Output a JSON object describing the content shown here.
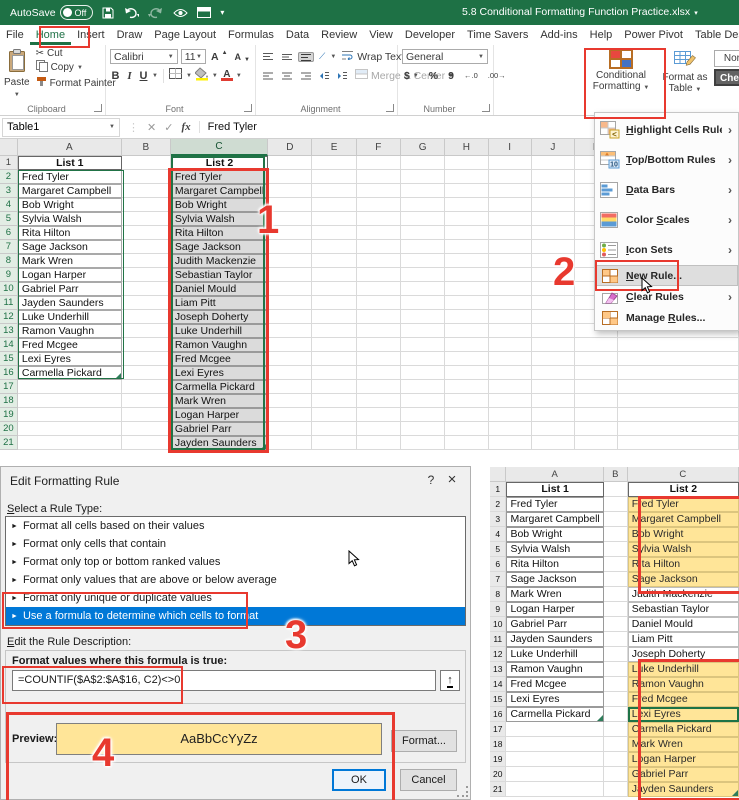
{
  "titlebar": {
    "autosave_label": "AutoSave",
    "autosave_state": "Off",
    "title": "5.8 Conditional Formatting Function Practice.xlsx"
  },
  "tabs": {
    "items": [
      "File",
      "Home",
      "Insert",
      "Draw",
      "Page Layout",
      "Formulas",
      "Data",
      "Review",
      "View",
      "Developer",
      "Time Savers",
      "Add-ins",
      "Help",
      "Power Pivot",
      "Table Des"
    ],
    "active": "Home"
  },
  "ribbon": {
    "clipboard": {
      "group_label": "Clipboard",
      "paste": "Paste",
      "cut": "Cut",
      "copy": "Copy",
      "format_painter": "Format Painter"
    },
    "font": {
      "group_label": "Font",
      "font_name": "Calibri",
      "font_size": "11",
      "bold": "B",
      "italic": "I",
      "underline": "U"
    },
    "alignment": {
      "group_label": "Alignment",
      "wrap_text": "Wrap Text",
      "merge_center": "Merge & Center"
    },
    "number": {
      "group_label": "Number",
      "format": "General",
      "currency": "$",
      "percent": "%",
      "comma": "9",
      "inc_decimal": "←.0",
      "dec_decimal": ".00→"
    },
    "styles": {
      "conditional_formatting_line1": "Conditional",
      "conditional_formatting_line2": "Formatting",
      "format_as_table_line1": "Format as",
      "format_as_table_line2": "Table",
      "style_normal": "Normal",
      "style_check_cell": "Check C"
    }
  },
  "formula_bar": {
    "name_box": "Table1",
    "fx_label": "fx",
    "value": "Fred Tyler"
  },
  "sheet_top": {
    "columns": [
      "A",
      "B",
      "C",
      "D",
      "E",
      "F",
      "G",
      "H",
      "I",
      "J",
      "K"
    ],
    "selected_column": "C",
    "rows": 21,
    "list1_header": "List 1",
    "list2_header": "List 2",
    "list1": [
      "Fred Tyler",
      "Margaret Campbell",
      "Bob Wright",
      "Sylvia Walsh",
      "Rita Hilton",
      "Sage Jackson",
      "Mark Wren",
      "Logan Harper",
      "Gabriel Parr",
      "Jayden Saunders",
      "Luke Underhill",
      "Ramon Vaughn",
      "Fred Mcgee",
      "Lexi Eyres",
      "Carmella Pickard"
    ],
    "list2": [
      "Fred Tyler",
      "Margaret Campbell",
      "Bob Wright",
      "Sylvia Walsh",
      "Rita Hilton",
      "Sage Jackson",
      "Judith Mackenzie",
      "Sebastian Taylor",
      "Daniel Mould",
      "Liam Pitt",
      "Joseph Doherty",
      "Luke Underhill",
      "Ramon Vaughn",
      "Fred Mcgee",
      "Lexi Eyres",
      "Carmella Pickard",
      "Mark Wren",
      "Logan Harper",
      "Gabriel Parr",
      "Jayden Saunders"
    ]
  },
  "cf_menu": {
    "items": [
      {
        "label": "Highlight Cells Rules",
        "icon": "highlight-cells-rules-icon",
        "submenu": true,
        "accel": "H"
      },
      {
        "label": "Top/Bottom Rules",
        "icon": "top-bottom-rules-icon",
        "submenu": true,
        "accel": "T"
      },
      {
        "label": "Data Bars",
        "icon": "data-bars-icon",
        "submenu": true,
        "accel": "D"
      },
      {
        "label": "Color Scales",
        "icon": "color-scales-icon",
        "submenu": true,
        "accel": "S"
      },
      {
        "label": "Icon Sets",
        "icon": "icon-sets-icon",
        "submenu": true,
        "accel": "I"
      },
      {
        "label": "New Rule...",
        "icon": "new-rule-icon",
        "submenu": false,
        "accel": "N",
        "highlighted": true
      },
      {
        "label": "Clear Rules",
        "icon": "clear-rules-icon",
        "submenu": true,
        "accel": "C"
      },
      {
        "label": "Manage Rules...",
        "icon": "manage-rules-icon",
        "submenu": false,
        "accel": "R"
      }
    ]
  },
  "dialog": {
    "title": "Edit Formatting Rule",
    "help_button": "?",
    "close_button": "×",
    "select_rule_label": "Select a Rule Type:",
    "rule_types": [
      "Format all cells based on their values",
      "Format only cells that contain",
      "Format only top or bottom ranked values",
      "Format only values that are above or below average",
      "Format only unique or duplicate values",
      "Use a formula to determine which cells to format"
    ],
    "selected_rule_index": 5,
    "edit_description_label": "Edit the Rule Description:",
    "formula_label": "Format values where this formula is true:",
    "formula_value": "=COUNTIF($A$2:$A$16, C2)<>0",
    "preview_label": "Preview:",
    "preview_text": "AaBbCcYyZz",
    "format_button": "Format...",
    "ok_button": "OK",
    "cancel_button": "Cancel"
  },
  "sheet_result": {
    "columns": [
      "A",
      "B",
      "C"
    ],
    "rows": 21,
    "list1_header": "List 1",
    "list2_header": "List 2",
    "list1": [
      "Fred Tyler",
      "Margaret Campbell",
      "Bob Wright",
      "Sylvia Walsh",
      "Rita Hilton",
      "Sage Jackson",
      "Mark Wren",
      "Logan Harper",
      "Gabriel Parr",
      "Jayden Saunders",
      "Luke Underhill",
      "Ramon Vaughn",
      "Fred Mcgee",
      "Lexi Eyres",
      "Carmella Pickard"
    ],
    "list2": [
      {
        "text": "Fred Tyler",
        "highlighted": true
      },
      {
        "text": "Margaret Campbell",
        "highlighted": true
      },
      {
        "text": "Bob Wright",
        "highlighted": true
      },
      {
        "text": "Sylvia Walsh",
        "highlighted": true
      },
      {
        "text": "Rita Hilton",
        "highlighted": true
      },
      {
        "text": "Sage Jackson",
        "highlighted": true
      },
      {
        "text": "Judith Mackenzie",
        "highlighted": false
      },
      {
        "text": "Sebastian Taylor",
        "highlighted": false
      },
      {
        "text": "Daniel Mould",
        "highlighted": false
      },
      {
        "text": "Liam Pitt",
        "highlighted": false
      },
      {
        "text": "Joseph Doherty",
        "highlighted": false
      },
      {
        "text": "Luke Underhill",
        "highlighted": true
      },
      {
        "text": "Ramon Vaughn",
        "highlighted": true
      },
      {
        "text": "Fred Mcgee",
        "highlighted": true
      },
      {
        "text": "Lexi Eyres",
        "highlighted": true
      },
      {
        "text": "Carmella Pickard",
        "highlighted": true
      },
      {
        "text": "Mark Wren",
        "highlighted": true
      },
      {
        "text": "Logan Harper",
        "highlighted": true
      },
      {
        "text": "Gabriel Parr",
        "highlighted": true
      },
      {
        "text": "Jayden Saunders",
        "highlighted": true
      }
    ]
  },
  "annotations": {
    "step1": "1",
    "step2": "2",
    "step3": "3",
    "step4": "4"
  },
  "colors": {
    "excel_green": "#1E7145",
    "selection_blue": "#0078D7",
    "highlight_yellow": "#FFE598",
    "annotation_red": "#E8392F"
  }
}
